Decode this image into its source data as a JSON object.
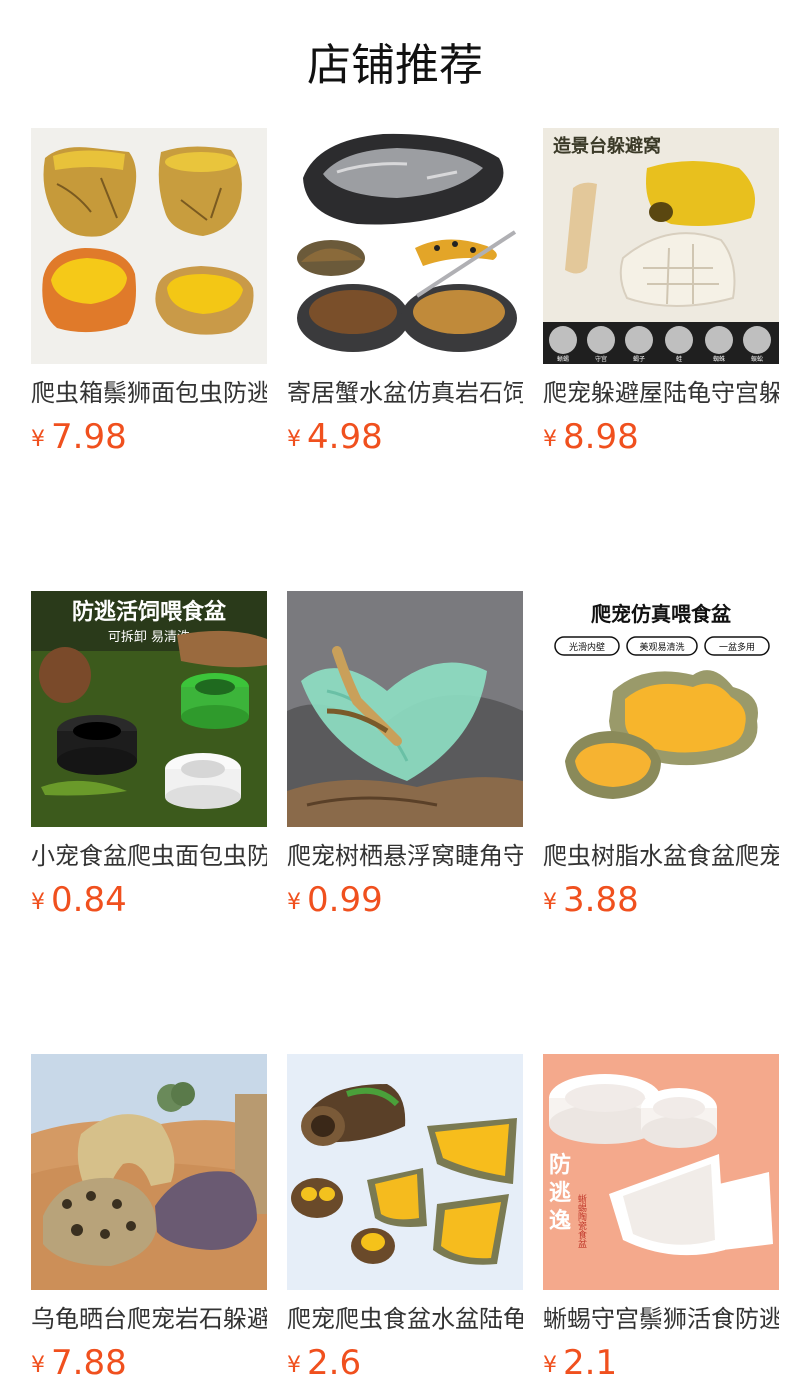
{
  "store": {
    "title": "店铺推荐"
  },
  "colors": {
    "price": "#f0501e",
    "title": "#111111",
    "name": "#333333"
  },
  "products": [
    {
      "name": "爬虫箱鬃狮面包虫防逃食盆",
      "currency": "¥",
      "price": "7.98",
      "image": "yellow-rock-dishes"
    },
    {
      "name": "寄居蟹水盆仿真岩石饲料盆",
      "currency": "¥",
      "price": "4.98",
      "image": "grey-rock-water-bowl"
    },
    {
      "name": "爬宠躲避屋陆龟守宫躲避窝",
      "currency": "¥",
      "price": "8.98",
      "image": "hide-caves",
      "badge": "造景台躲避窝",
      "strip_labels": [
        "蜥蜴",
        "守宫",
        "蝎子",
        "蛙",
        "蜘蛛",
        "蜈蚣"
      ]
    },
    {
      "name": "小宠食盆爬虫面包虫防逃盆",
      "currency": "¥",
      "price": "0.84",
      "image": "anti-escape-bowls",
      "banner": "防逃活饲喂食盆",
      "subtitle": "可拆卸 易清洗"
    },
    {
      "name": "爬宠树栖悬浮窝睫角守宫",
      "currency": "¥",
      "price": "0.99",
      "image": "leaf-hammock"
    },
    {
      "name": "爬虫树脂水盆食盆爬宠用品",
      "currency": "¥",
      "price": "3.88",
      "image": "resin-feeding-bowls",
      "headline": "爬宠仿真喂食盆",
      "tags": [
        "光滑内壁",
        "美观易清洗",
        "一盆多用"
      ]
    },
    {
      "name": "乌龟晒台爬宠岩石躲避洞",
      "currency": "¥",
      "price": "7.88",
      "image": "desert-hides"
    },
    {
      "name": "爬宠爬虫食盆水盆陆龟树桩",
      "currency": "¥",
      "price": "2.6",
      "image": "log-bowls"
    },
    {
      "name": "蜥蜴守宫鬃狮活食防逃盆",
      "currency": "¥",
      "price": "2.1",
      "image": "ceramic-bowls",
      "promo_lines": [
        "防",
        "逃",
        "逸"
      ],
      "promo_side": "蜥蜴陶瓷食盆"
    }
  ]
}
